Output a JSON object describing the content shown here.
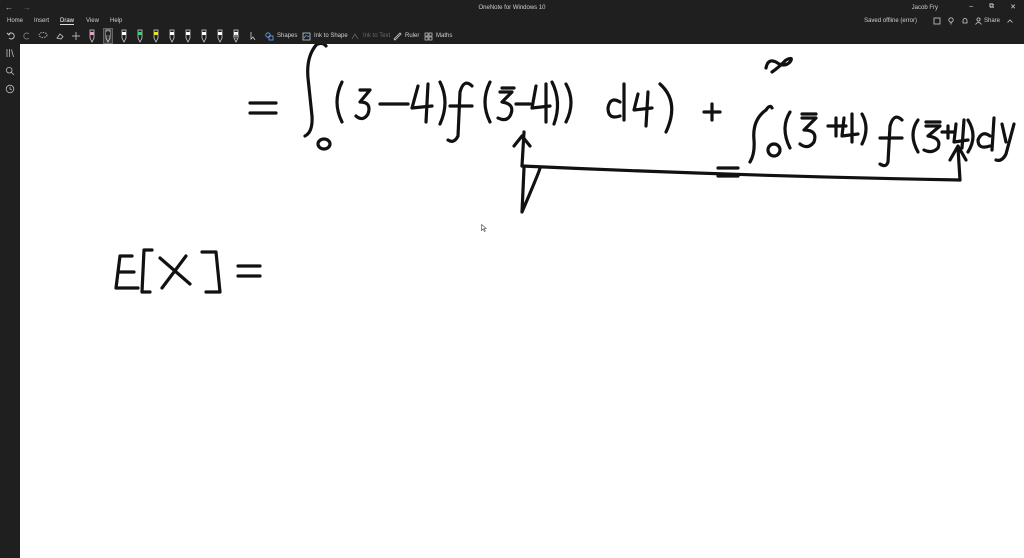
{
  "titlebar": {
    "app_title": "OneNote for Windows 10",
    "user": "Jacob Fry",
    "back_glyph": "←",
    "forward_glyph": "→",
    "min_glyph": "–",
    "max_glyph": "⧉",
    "close_glyph": "✕"
  },
  "menu": {
    "tabs": [
      "Home",
      "Insert",
      "Draw",
      "View",
      "Help"
    ],
    "active_tab": "Draw",
    "status": "Saved offline (error)",
    "share_label": "Share"
  },
  "toolbar": {
    "shapes_label": "Shapes",
    "ink_to_shape_label": "Ink to Shape",
    "ink_to_text_label": "Ink to Text",
    "ruler_label": "Ruler",
    "maths_label": "Maths",
    "pen_colors": [
      "#e8a0c8",
      "#222222",
      "#ffffff",
      "#3ad07a",
      "#f0e020",
      "#ffffff",
      "#ffffff",
      "#ffffff",
      "#ffffff",
      "#ffffff"
    ]
  },
  "colors": {
    "chrome": "#1f1f1f",
    "canvas": "#ffffff",
    "ink": "#111111"
  },
  "icons": {
    "undo": "undo-icon",
    "redo": "redo-icon",
    "lasso": "lasso-select-icon",
    "eraser": "eraser-icon",
    "add_pen": "add-pen-icon",
    "ruler": "ruler-icon",
    "maths": "maths-icon"
  }
}
